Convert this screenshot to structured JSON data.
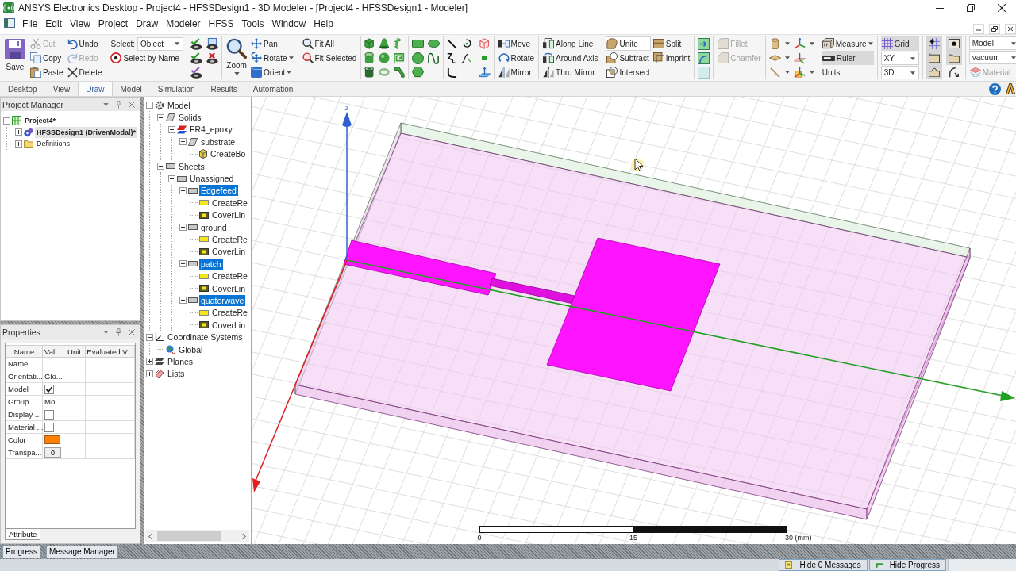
{
  "window": {
    "title": "ANSYS Electronics Desktop - Project4 - HFSSDesign1 - 3D Modeler - [Project4 - HFSSDesign1 - Modeler]"
  },
  "menu": [
    "File",
    "Edit",
    "View",
    "Project",
    "Draw",
    "Modeler",
    "HFSS",
    "Tools",
    "Window",
    "Help"
  ],
  "ribbon": {
    "clipboard": {
      "save": "Save",
      "edit": [
        {
          "label": "Cut",
          "disabled": true
        },
        {
          "label": "Copy",
          "disabled": false
        },
        {
          "label": "Paste",
          "disabled": false
        }
      ],
      "history": [
        {
          "label": "Undo",
          "disabled": false
        },
        {
          "label": "Redo",
          "disabled": true
        },
        {
          "label": "Delete",
          "disabled": false
        }
      ]
    },
    "select": {
      "label": "Select:",
      "value": "Object",
      "by_name": "Select by Name"
    },
    "navigate": {
      "zoom": "Zoom",
      "tools": [
        {
          "label": "Pan",
          "dropdown": false
        },
        {
          "label": "Rotate",
          "dropdown": true
        },
        {
          "label": "Orient",
          "dropdown": true
        }
      ]
    },
    "fit": [
      "Fit All",
      "Fit Selected"
    ],
    "transform": [
      "Move",
      "Rotate",
      "Mirror"
    ],
    "duplicate": [
      "Along Line",
      "Around Axis",
      "Thru Mirror"
    ],
    "boolean": [
      {
        "label": "Unite",
        "highlighted": true
      },
      {
        "label": "Subtract",
        "highlighted": false
      },
      {
        "label": "Intersect",
        "highlighted": false
      }
    ],
    "split": [
      "Split",
      "Imprint"
    ],
    "edges": [
      {
        "label": "Fillet",
        "disabled": true
      },
      {
        "label": "Chamfer",
        "disabled": true
      }
    ],
    "measure": {
      "measure": "Measure",
      "ruler": {
        "label": "Ruler",
        "selected": true
      },
      "units": "Units"
    },
    "grid": {
      "label": "Grid",
      "selected": true,
      "plane": "XY",
      "view": "3D"
    },
    "snap_toggles": [
      {
        "selected": true
      },
      {
        "selected": true
      },
      {
        "selected": true
      },
      {
        "selected": true
      },
      {
        "selected": true
      },
      {
        "selected": false
      }
    ],
    "material": {
      "mode": "Model",
      "value": "vacuum",
      "button": "Material",
      "disabled": true
    }
  },
  "ribbon_tabs": [
    {
      "label": "Desktop",
      "selected": false
    },
    {
      "label": "View",
      "selected": false
    },
    {
      "label": "Draw",
      "selected": true
    },
    {
      "label": "Model",
      "selected": false
    },
    {
      "label": "Simulation",
      "selected": false
    },
    {
      "label": "Results",
      "selected": false
    },
    {
      "label": "Automation",
      "selected": false
    }
  ],
  "project_manager": {
    "title": "Project Manager",
    "tree": [
      {
        "label": "Project4*",
        "kind": "project",
        "expanded": true,
        "selected": false,
        "children": [
          {
            "label": "HFSSDesign1 (DrivenModal)*",
            "kind": "design",
            "expanded": false,
            "selected": true
          },
          {
            "label": "Definitions",
            "kind": "folder",
            "expanded": false,
            "selected": false
          }
        ]
      }
    ]
  },
  "properties": {
    "title": "Properties",
    "columns": [
      "Name",
      "Val...",
      "Unit",
      "Evaluated V..."
    ],
    "rows": [
      {
        "name": "Name",
        "kind": "text"
      },
      {
        "name": "Orientati...",
        "kind": "text",
        "value": "Glo..."
      },
      {
        "name": "Model",
        "kind": "checkbox",
        "checked": true
      },
      {
        "name": "Group",
        "kind": "text",
        "value": "Mo..."
      },
      {
        "name": "Display ...",
        "kind": "checkbox",
        "checked": false
      },
      {
        "name": "Material ...",
        "kind": "checkbox",
        "checked": false
      },
      {
        "name": "Color",
        "kind": "color",
        "color": "#ff8000"
      },
      {
        "name": "Transpa...",
        "kind": "button",
        "value": "0"
      }
    ],
    "tab": "Attribute"
  },
  "model_tree": [
    {
      "label": "Model",
      "kind": "model",
      "expanded": true,
      "selected": false,
      "children": [
        {
          "label": "Solids",
          "kind": "solids",
          "expanded": true,
          "selected": false,
          "children": [
            {
              "label": "FR4_epoxy",
              "kind": "material",
              "expanded": true,
              "selected": false,
              "children": [
                {
                  "label": "substrate",
                  "kind": "solid",
                  "expanded": true,
                  "selected": false,
                  "children": [
                    {
                      "label": "CreateBo",
                      "kind": "box-op",
                      "selected": false
                    }
                  ]
                }
              ]
            }
          ]
        },
        {
          "label": "Sheets",
          "kind": "sheets",
          "expanded": true,
          "selected": false,
          "children": [
            {
              "label": "Unassigned",
              "kind": "sheet",
              "expanded": true,
              "selected": false,
              "children": [
                {
                  "label": "Edgefeed",
                  "kind": "sheet",
                  "expanded": true,
                  "selected": true,
                  "children": [
                    {
                      "label": "CreateRe",
                      "kind": "rect-op",
                      "selected": false
                    },
                    {
                      "label": "CoverLin",
                      "kind": "cover-op",
                      "selected": false
                    }
                  ]
                },
                {
                  "label": "ground",
                  "kind": "sheet",
                  "expanded": true,
                  "selected": false,
                  "children": [
                    {
                      "label": "CreateRe",
                      "kind": "rect-op",
                      "selected": false
                    },
                    {
                      "label": "CoverLin",
                      "kind": "cover-op",
                      "selected": false
                    }
                  ]
                },
                {
                  "label": "patch",
                  "kind": "sheet",
                  "expanded": true,
                  "selected": true,
                  "children": [
                    {
                      "label": "CreateRe",
                      "kind": "rect-op",
                      "selected": false
                    },
                    {
                      "label": "CoverLin",
                      "kind": "cover-op",
                      "selected": false
                    }
                  ]
                },
                {
                  "label": "quaterwave",
                  "kind": "sheet",
                  "expanded": true,
                  "selected": true,
                  "children": [
                    {
                      "label": "CreateRe",
                      "kind": "rect-op",
                      "selected": false
                    },
                    {
                      "label": "CoverLin",
                      "kind": "cover-op",
                      "selected": false
                    }
                  ]
                }
              ]
            }
          ]
        }
      ]
    },
    {
      "label": "Coordinate Systems",
      "kind": "coords",
      "expanded": true,
      "selected": false,
      "children": [
        {
          "label": "Global",
          "kind": "global",
          "selected": false
        }
      ]
    },
    {
      "label": "Planes",
      "kind": "planes",
      "expanded": false,
      "selected": false
    },
    {
      "label": "Lists",
      "kind": "lists",
      "expanded": false,
      "selected": false
    }
  ],
  "viewport": {
    "axis_label": "Z",
    "scale_labels": [
      "0",
      "15",
      "30 (mm)"
    ]
  },
  "dock_tabs": [
    "Progress",
    "Message Manager"
  ],
  "status_bar": {
    "messages": "Hide 0 Messages",
    "progress": "Hide Progress"
  }
}
